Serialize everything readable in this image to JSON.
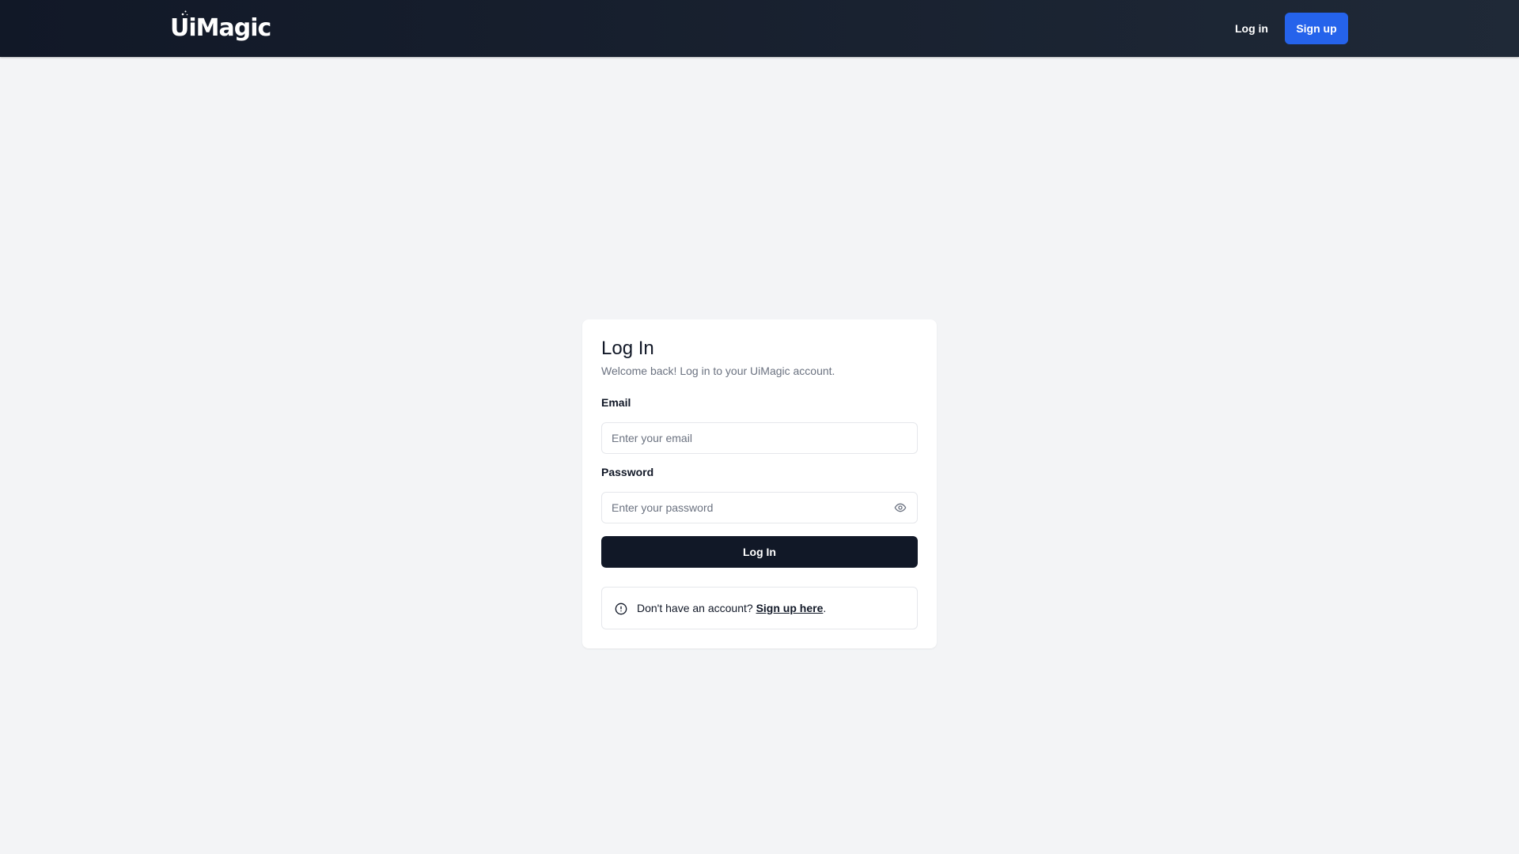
{
  "header": {
    "logo": "UiMagic",
    "login_label": "Log in",
    "signup_label": "Sign up"
  },
  "login_card": {
    "title": "Log In",
    "subtitle": "Welcome back! Log in to your UiMagic account.",
    "email": {
      "label": "Email",
      "placeholder": "Enter your email",
      "value": ""
    },
    "password": {
      "label": "Password",
      "placeholder": "Enter your password",
      "value": "",
      "toggle_icon": "eye-icon"
    },
    "submit_label": "Log In",
    "notice": {
      "icon": "info-circle-icon",
      "prefix": "Don't have an account? ",
      "link_label": "Sign up here",
      "suffix": "."
    }
  },
  "colors": {
    "header_bg": "#111827",
    "page_bg": "#f3f4f6",
    "primary_blue": "#2563eb",
    "button_dark": "#111827"
  }
}
